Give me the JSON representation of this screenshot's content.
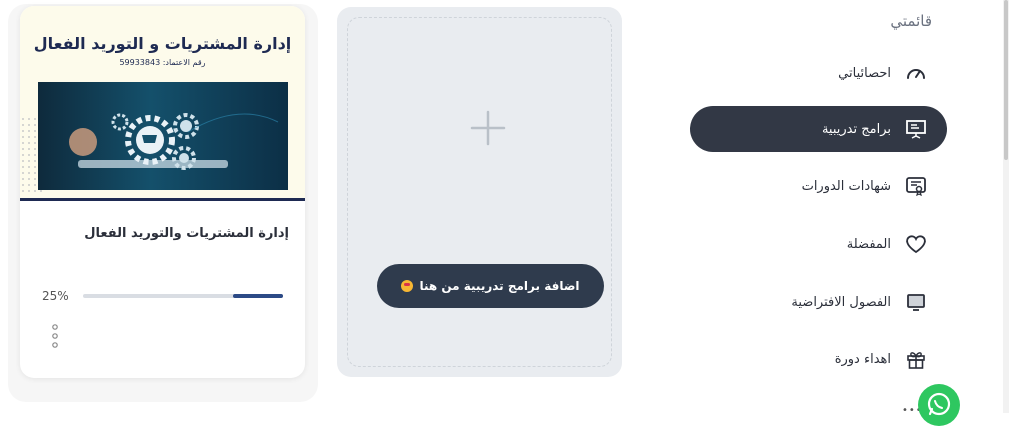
{
  "sidebar": {
    "title": "قائمتي",
    "items": [
      {
        "label": "احصائياتي",
        "icon": "speedometer-icon",
        "active": false
      },
      {
        "label": "برامج تدريبية",
        "icon": "presentation-board-icon",
        "active": true
      },
      {
        "label": "شهادات الدورات",
        "icon": "certificate-icon",
        "active": false
      },
      {
        "label": "المفضلة",
        "icon": "heart-icon",
        "active": false
      },
      {
        "label": "الفصول الافتراضية",
        "icon": "monitor-icon",
        "active": false
      },
      {
        "label": "اهداء دورة",
        "icon": "gift-icon",
        "active": false
      }
    ]
  },
  "add_card": {
    "button_label": "اضافة برامج تدريبية من هنا"
  },
  "course": {
    "banner_title": "إدارة المشتريات و التوريد الفعال",
    "banner_subtitle": "رقم الاعتماد: 59933843",
    "name": "إدارة المشتريات والتوريد الفعال",
    "progress_label": "25%",
    "progress_fraction": 0.25
  },
  "colors": {
    "active_bg": "#323845",
    "button_bg": "#2f3b4d",
    "progress": "#2c4a86",
    "whatsapp": "#2ec760"
  }
}
